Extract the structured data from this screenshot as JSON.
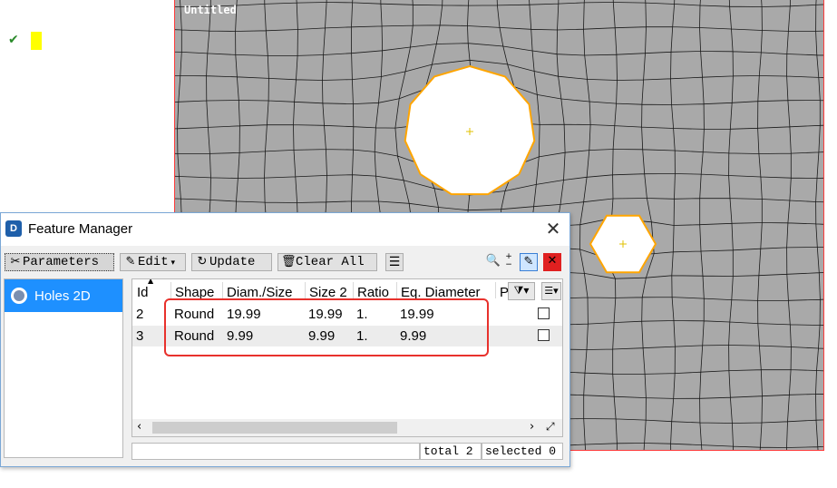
{
  "viewport": {
    "title": "Untitled"
  },
  "colors": {
    "accent": "#1e90ff",
    "highlight": "#e8312c",
    "mesh_fill": "#a9a9a9",
    "hole_edge": "#ffa500"
  },
  "dialog": {
    "title": "Feature Manager",
    "close_icon": "close-icon",
    "toolbar": {
      "parameters": "Parameters",
      "edit": "Edit",
      "update": "Update",
      "clear_all": "Clear All"
    },
    "sidebar": {
      "items": [
        {
          "label": "Holes 2D",
          "icon": "hole-icon"
        }
      ]
    },
    "table": {
      "columns": [
        "Id",
        "Shape",
        "Diam./Size",
        "Size 2",
        "Ratio",
        "Eq. Diameter",
        "P"
      ],
      "rows": [
        {
          "id": "2",
          "shape": "Round",
          "diam": "19.99",
          "size2": "19.99",
          "ratio": "1.",
          "eq": "19.99",
          "checked": false
        },
        {
          "id": "3",
          "shape": "Round",
          "diam": "9.99",
          "size2": "9.99",
          "ratio": "1.",
          "eq": "9.99",
          "checked": false
        }
      ]
    },
    "status": {
      "total": "total 2",
      "selected": "selected 0"
    }
  }
}
